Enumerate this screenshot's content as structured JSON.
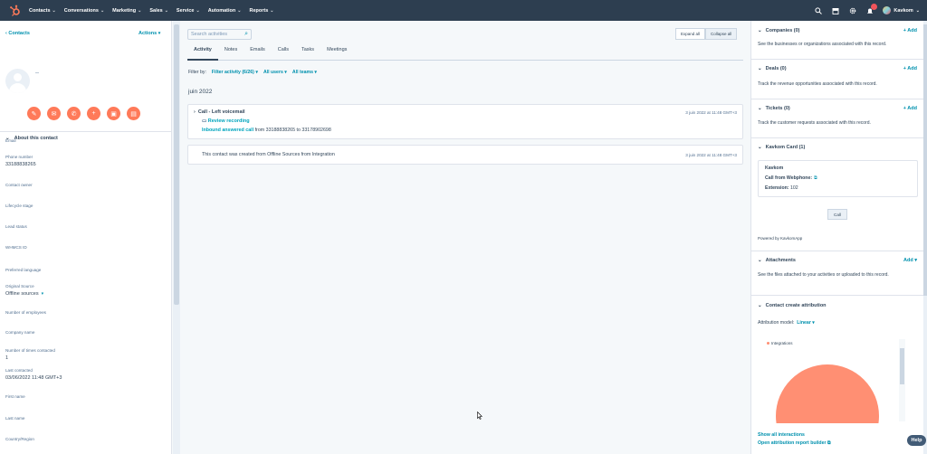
{
  "topnav": {
    "items": [
      {
        "label": "Contacts"
      },
      {
        "label": "Conversations"
      },
      {
        "label": "Marketing"
      },
      {
        "label": "Sales"
      },
      {
        "label": "Service"
      },
      {
        "label": "Automation"
      },
      {
        "label": "Reports"
      }
    ],
    "account_name": "Kavkom",
    "colors": {
      "bg": "#2d3e50",
      "accent": "#ff7a59"
    }
  },
  "left": {
    "back_label": "Contacts",
    "actions_label": "Actions",
    "contact_name": "--",
    "about_title": "About this contact",
    "properties": [
      {
        "label": "Email",
        "value": ""
      },
      {
        "label": "Phone number",
        "value": "33188838265"
      },
      {
        "label": "Contact owner",
        "value": ""
      },
      {
        "label": "Lifecycle stage",
        "value": ""
      },
      {
        "label": "Lead status",
        "value": ""
      },
      {
        "label": "WHMCS ID",
        "value": ""
      },
      {
        "label": "Preferred language",
        "value": ""
      },
      {
        "label": "Original Source",
        "value": "Offline sources"
      },
      {
        "label": "Number of employees",
        "value": ""
      },
      {
        "label": "Company name",
        "value": ""
      },
      {
        "label": "Number of times contacted",
        "value": "1"
      },
      {
        "label": "Last contacted",
        "value": "03/06/2022 11:48 GMT+3"
      },
      {
        "label": "First name",
        "value": ""
      },
      {
        "label": "Last name",
        "value": ""
      },
      {
        "label": "Country/Region",
        "value": ""
      }
    ]
  },
  "middle": {
    "search_placeholder": "Search activities",
    "expand_all": "Expand all",
    "collapse_all": "Collapse all",
    "tabs": [
      "Activity",
      "Notes",
      "Emails",
      "Calls",
      "Tasks",
      "Meetings"
    ],
    "filter_by": "Filter by:",
    "filter_activity": "Filter activity (6/26)",
    "filter_users": "All users",
    "filter_teams": "All teams",
    "month": "juin 2022",
    "activities": [
      {
        "title": "Call - Left voicemail",
        "timestamp": "3 juin 2022 at 11:48 GMT+3",
        "link": "Review recording",
        "detail_bold": "Inbound answered call",
        "detail_rest": " from 33188838265 to 33178902698"
      },
      {
        "text": "This contact was created from Offline Sources from Integration",
        "timestamp": "3 juin 2022 at 11:48 GMT+3"
      }
    ]
  },
  "right": {
    "sections": [
      {
        "title": "Companies (0)",
        "add": "+ Add",
        "desc": "See the businesses or organizations associated with this record."
      },
      {
        "title": "Deals (0)",
        "add": "+ Add",
        "desc": "Track the revenue opportunities associated with this record."
      },
      {
        "title": "Tickets (0)",
        "add": "+ Add",
        "desc": "Track the customer requests associated with this record."
      }
    ],
    "kavkom": {
      "title": "Kavkom Card (1)",
      "name": "Kavkom",
      "call_from": "Call from Webphone:",
      "ext_label": "Extension:",
      "ext_value": "102",
      "call_button": "Call",
      "powered": "Powered by KavkomApp"
    },
    "attachments": {
      "title": "Attachments",
      "add": "Add",
      "desc": "See the files attached to your activities or uploaded to this record."
    },
    "attribution": {
      "title": "Contact create attribution",
      "model_label": "Attribution model:",
      "model_value": "Linear",
      "show_all": "Show all interactions",
      "open_builder": "Open attribution report builder"
    }
  },
  "chart_data": {
    "type": "pie",
    "categories": [
      "Integrations"
    ],
    "values": [
      100
    ],
    "colors": [
      "#ff8f73"
    ],
    "legend": "top-left"
  },
  "help_label": "Help"
}
